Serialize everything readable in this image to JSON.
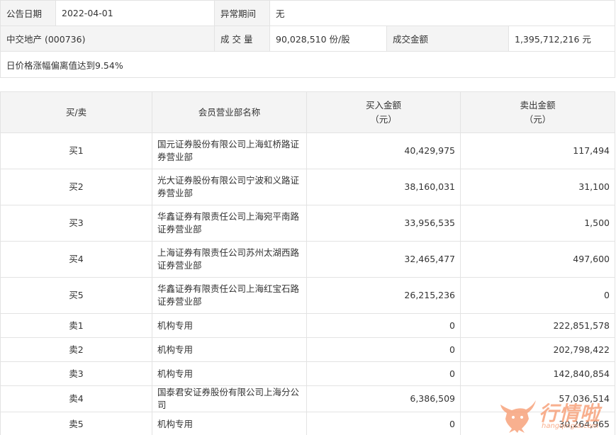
{
  "info": {
    "announce_date_label": "公告日期",
    "announce_date_value": "2022-04-01",
    "abnormal_period_label": "异常期间",
    "abnormal_period_value": "无",
    "stock": "中交地产 (000736)",
    "volume_label": "成 交 量",
    "volume_value": "90,028,510 份/股",
    "amount_label": "成交金额",
    "amount_value": "1,395,712,216 元",
    "reason": "日价格涨幅偏离值达到9.54%"
  },
  "table": {
    "headers": {
      "side": "买/卖",
      "broker": "会员营业部名称",
      "buy_line1": "买入金额",
      "buy_line2": "（元）",
      "sell_line1": "卖出金额",
      "sell_line2": "（元）"
    },
    "rows": [
      {
        "side": "买1",
        "broker": "国元证券股份有限公司上海虹桥路证券营业部",
        "buy": "40,429,975",
        "sell": "117,494"
      },
      {
        "side": "买2",
        "broker": "光大证券股份有限公司宁波和义路证券营业部",
        "buy": "38,160,031",
        "sell": "31,100"
      },
      {
        "side": "买3",
        "broker": "华鑫证券有限责任公司上海宛平南路证券营业部",
        "buy": "33,956,535",
        "sell": "1,500"
      },
      {
        "side": "买4",
        "broker": "上海证券有限责任公司苏州太湖西路证券营业部",
        "buy": "32,465,477",
        "sell": "497,600"
      },
      {
        "side": "买5",
        "broker": "华鑫证券有限责任公司上海红宝石路证券营业部",
        "buy": "26,215,236",
        "sell": "0"
      },
      {
        "side": "卖1",
        "broker": "机构专用",
        "buy": "0",
        "sell": "222,851,578"
      },
      {
        "side": "卖2",
        "broker": "机构专用",
        "buy": "0",
        "sell": "202,798,422"
      },
      {
        "side": "卖3",
        "broker": "机构专用",
        "buy": "0",
        "sell": "142,840,854"
      },
      {
        "side": "卖4",
        "broker": "国泰君安证券股份有限公司上海分公司",
        "buy": "6,386,509",
        "sell": "57,036,514"
      },
      {
        "side": "卖5",
        "broker": "机构专用",
        "buy": "0",
        "sell": "30,264,965"
      }
    ]
  },
  "watermark": {
    "title": "行情啦",
    "domain": "hangqingla.com",
    "color": "#f7a27b",
    "icon": "bull-logo-icon"
  }
}
